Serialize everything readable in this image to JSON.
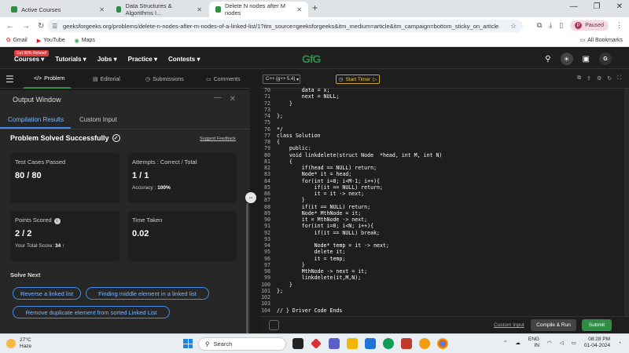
{
  "browser": {
    "tabs": [
      {
        "label": "Active Courses",
        "active": false
      },
      {
        "label": "Data Structures & Algorithms I...",
        "active": false
      },
      {
        "label": "Delete N nodes after M nodes",
        "active": true
      }
    ],
    "url": "geeksforgeeks.org/problems/delete-n-nodes-after-m-nodes-of-a-linked-list/1?itm_source=geeksforgeeks&itm_medium=article&itm_campaign=bottom_sticky_on_article",
    "profile_status": "Paused",
    "profile_initial": "P",
    "bookmarks": [
      "Gmail",
      "YouTube",
      "Maps"
    ],
    "all_bookmarks": "All Bookmarks"
  },
  "site": {
    "promo_badge": "Get 90% Refund!",
    "nav": [
      "Courses",
      "Tutorials",
      "Jobs",
      "Practice",
      "Contests"
    ],
    "logo": "GfG",
    "user_initial": "G"
  },
  "left_tabs": [
    "Problem",
    "Editorial",
    "Submissions",
    "Comments"
  ],
  "output": {
    "title": "Output Window",
    "tabs": [
      "Compilation Results",
      "Custom Input"
    ],
    "status": "Problem Solved Successfully",
    "feedback": "Suggest Feedback",
    "test_cases_label": "Test Cases Passed",
    "test_cases_value": "80 / 80",
    "attempts_label": "Attempts : Correct / Total",
    "attempts_value": "1 / 1",
    "accuracy_label": "Accuracy :",
    "accuracy_value": "100%",
    "points_label": "Points Scored",
    "points_value": "2 / 2",
    "total_score_label": "Your Total Score:",
    "total_score_value": "34",
    "time_label": "Time Taken",
    "time_value": "0.02",
    "solve_next_label": "Solve Next",
    "solve_next": [
      "Reverse a linked list",
      "Finding middle element in a linked list",
      "Remove duplicate element from sorted Linked List"
    ]
  },
  "editor": {
    "language": "C++ (g++ 5.4)",
    "timer_label": "Start Timer",
    "lines": [
      {
        "n": "70",
        "t": "        data = x;"
      },
      {
        "n": "71",
        "t": "        next = NULL;"
      },
      {
        "n": "72",
        "t": "    }"
      },
      {
        "n": "73",
        "t": ""
      },
      {
        "n": "74",
        "t": "};"
      },
      {
        "n": "75",
        "t": ""
      },
      {
        "n": "76",
        "t": "*/"
      },
      {
        "n": "77",
        "t": "class Solution"
      },
      {
        "n": "78",
        "t": "{"
      },
      {
        "n": "79",
        "t": "    public:"
      },
      {
        "n": "80",
        "t": "    void linkdelete(struct Node  *head, int M, int N)"
      },
      {
        "n": "81",
        "t": "    {"
      },
      {
        "n": "82",
        "t": "        if(head == NULL) return;"
      },
      {
        "n": "83",
        "t": "        Node* it = head;"
      },
      {
        "n": "84",
        "t": "        for(int i=0; i<M-1; i++){"
      },
      {
        "n": "85",
        "t": "            if(it == NULL) return;"
      },
      {
        "n": "86",
        "t": "            it = it -> next;"
      },
      {
        "n": "87",
        "t": "        }"
      },
      {
        "n": "88",
        "t": "        if(it == NULL) return;"
      },
      {
        "n": "89",
        "t": "        Node* MthNode = it;"
      },
      {
        "n": "90",
        "t": "        it = MthNode -> next;"
      },
      {
        "n": "91",
        "t": "        for(int i=0; i<N; i++){"
      },
      {
        "n": "92",
        "t": "            if(it == NULL) break;"
      },
      {
        "n": "93",
        "t": ""
      },
      {
        "n": "94",
        "t": "            Node* temp = it -> next;"
      },
      {
        "n": "95",
        "t": "            delete it;"
      },
      {
        "n": "96",
        "t": "            it = temp;"
      },
      {
        "n": "97",
        "t": "        }"
      },
      {
        "n": "98",
        "t": "        MthNode -> next = it;"
      },
      {
        "n": "99",
        "t": "        linkdelete(it,M,N);"
      },
      {
        "n": "100",
        "t": "    }"
      },
      {
        "n": "101",
        "t": "};"
      },
      {
        "n": "102",
        "t": ""
      },
      {
        "n": "103",
        "t": ""
      },
      {
        "n": "104",
        "t": "// } Driver Code Ends"
      }
    ],
    "custom_input": "Custom Input",
    "compile_label": "Compile & Run",
    "submit_label": "Submit"
  },
  "taskbar": {
    "temperature": "27°C",
    "weather": "Haze",
    "search_placeholder": "Search",
    "lang": "ENG",
    "region": "IN",
    "time": "08:28 PM",
    "date": "01-04-2024"
  }
}
